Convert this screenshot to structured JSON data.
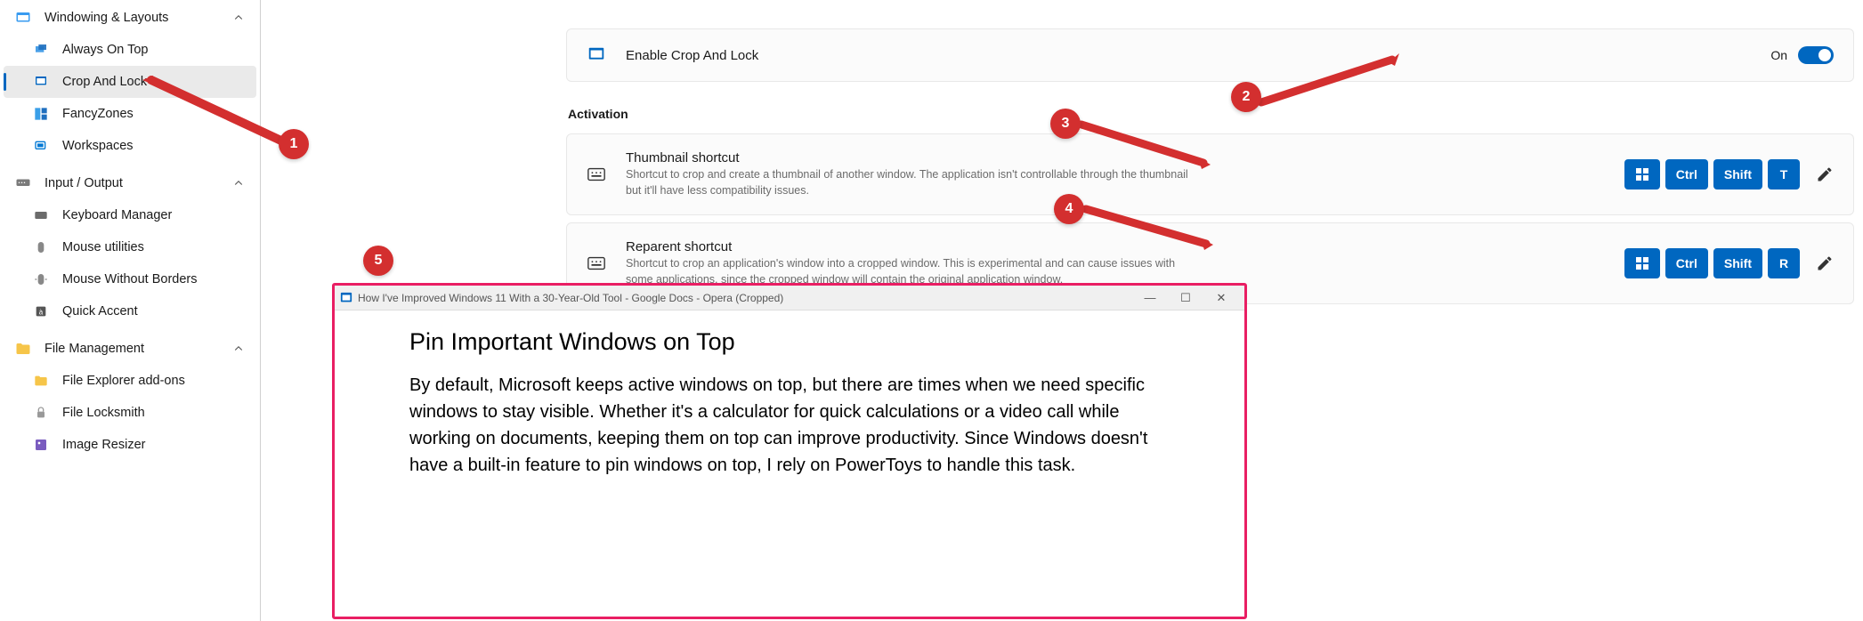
{
  "sidebar": {
    "sections": [
      {
        "label": "Windowing & Layouts",
        "icon": "windowing",
        "items": [
          {
            "label": "Always On Top",
            "icon": "always-on-top"
          },
          {
            "label": "Crop And Lock",
            "icon": "crop-lock",
            "selected": true
          },
          {
            "label": "FancyZones",
            "icon": "fancyzones"
          },
          {
            "label": "Workspaces",
            "icon": "workspaces"
          }
        ]
      },
      {
        "label": "Input / Output",
        "icon": "input-output",
        "items": [
          {
            "label": "Keyboard Manager",
            "icon": "keyboard"
          },
          {
            "label": "Mouse utilities",
            "icon": "mouse"
          },
          {
            "label": "Mouse Without Borders",
            "icon": "mouse-wb"
          },
          {
            "label": "Quick Accent",
            "icon": "quick-accent"
          }
        ]
      },
      {
        "label": "File Management",
        "icon": "file-mgmt",
        "items": [
          {
            "label": "File Explorer add-ons",
            "icon": "file-explorer"
          },
          {
            "label": "File Locksmith",
            "icon": "file-lock"
          },
          {
            "label": "Image Resizer",
            "icon": "image-resizer"
          }
        ]
      }
    ]
  },
  "main": {
    "enable": {
      "title": "Enable Crop And Lock",
      "state": "On"
    },
    "activation_header": "Activation",
    "thumbnail": {
      "title": "Thumbnail shortcut",
      "desc": "Shortcut to crop and create a thumbnail of another window. The application isn't controllable through the thumbnail but it'll have less compatibility issues.",
      "keys": [
        "Win",
        "Ctrl",
        "Shift",
        "T"
      ]
    },
    "reparent": {
      "title": "Reparent shortcut",
      "desc": "Shortcut to crop an application's window into a cropped window. This is experimental and can cause issues with some applications, since the cropped window will contain the original application window.",
      "keys": [
        "Win",
        "Ctrl",
        "Shift",
        "R"
      ]
    }
  },
  "annotations": {
    "1": "1",
    "2": "2",
    "3": "3",
    "4": "4",
    "5": "5"
  },
  "cropped": {
    "title": "How I've Improved Windows 11 With a 30-Year-Old Tool - Google Docs - Opera (Cropped)",
    "heading": "Pin Important Windows on Top",
    "body": "By default, Microsoft keeps active windows on top, but there are times when we need specific windows to stay visible. Whether it's a calculator for quick calculations or a video call while working on documents, keeping them on top can improve productivity. Since Windows doesn't have a built-in feature to pin windows on top, I rely on PowerToys to handle this task."
  }
}
